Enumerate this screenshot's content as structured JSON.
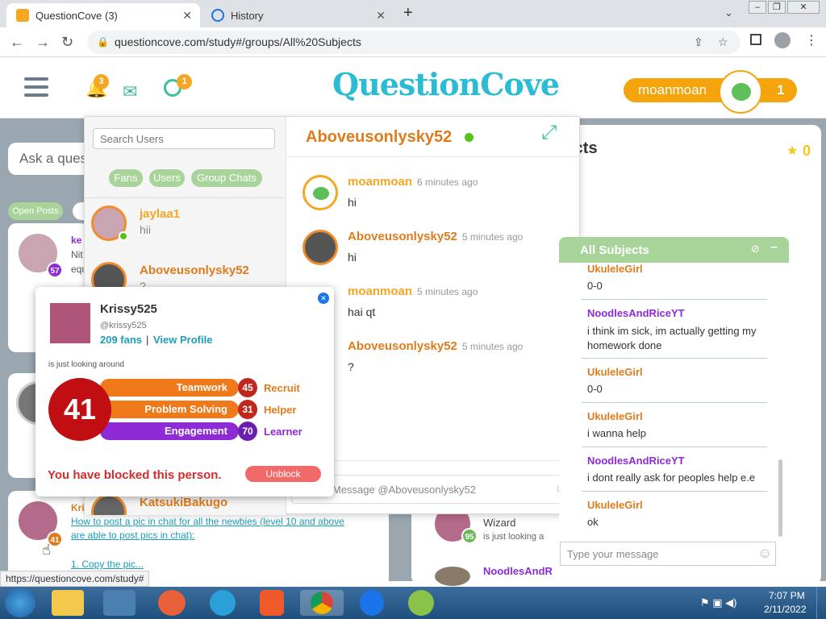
{
  "browser": {
    "tabs": [
      {
        "title": "QuestionCove (3)"
      },
      {
        "title": "History"
      }
    ],
    "new_tab": "+",
    "url": "questioncove.com/study#/groups/All%20Subjects",
    "status_url": "https://questioncove.com/study#"
  },
  "site": {
    "logo": "QuestionCove",
    "notif_count": "3",
    "friends_count": "1",
    "username": "moanmoan",
    "user_count": "1"
  },
  "background": {
    "ask_placeholder": "Ask a ques",
    "heading_partial": "jects",
    "open_posts": "Open Posts",
    "medal_count": "0",
    "card1_level": "57",
    "card2_level": "41",
    "card3_name_partial": "Kri",
    "card3_link1": "How to post a pic in chat for all the newbies (level 10 and above are able to post pics in chat):",
    "card3_link2": "1. Copy the pic...",
    "wizard_label": "Wizard",
    "wizard_status": "is just looking a",
    "wizard_level": "95",
    "bottom_name": "NoodlesAndR",
    "card1_name_partial": "ke",
    "card1_text_partial": "Nit",
    "card1_text_partial2": "equ"
  },
  "chat": {
    "search_placeholder": "Search Users",
    "filters": [
      "Fans",
      "Users",
      "Group Chats"
    ],
    "contacts": [
      {
        "name": "jaylaa1",
        "preview": "hii"
      },
      {
        "name": "Aboveusonlysky52",
        "preview": "?"
      },
      {
        "name": "KatsukiBakugo",
        "preview": ""
      }
    ],
    "partner": "Aboveusonlysky52",
    "messages": [
      {
        "name": "moanmoan",
        "time": "6 minutes ago",
        "text": "hi",
        "color": "#f5a623"
      },
      {
        "name": "Aboveusonlysky52",
        "time": "5 minutes ago",
        "text": "hi",
        "color": "#e07b1c"
      },
      {
        "name": "moanmoan",
        "time": "5 minutes ago",
        "text": "hai qt",
        "color": "#f5a623"
      },
      {
        "name": "Aboveusonlysky52",
        "time": "5 minutes ago",
        "text": "?",
        "color": "#e07b1c"
      }
    ],
    "input_placeholder": "Message @Aboveusonlysky52"
  },
  "profile": {
    "name": "Krissy525",
    "handle": "@krissy525",
    "fans": "209 fans",
    "view_profile": "View Profile",
    "status": "is just looking around",
    "score": "41",
    "stats": [
      {
        "label": "Teamwork",
        "value": "45",
        "rank": "Recruit",
        "color": "#f07a1a",
        "rank_color": "#e07b1c"
      },
      {
        "label": "Problem Solving",
        "value": "31",
        "rank": "Helper",
        "color": "#f07a1a",
        "rank_color": "#e07b1c"
      },
      {
        "label": "Engagement",
        "value": "70",
        "rank": "Learner",
        "color": "#8e2ad6",
        "rank_color": "#8e2ad6"
      }
    ],
    "blocked_text": "You have blocked this person.",
    "unblock": "Unblock"
  },
  "group_chat": {
    "title": "All Subjects",
    "messages": [
      {
        "name": "UkuleleGirl",
        "text": "0-0",
        "color": "#e07b1c"
      },
      {
        "name": "NoodlesAndRiceYT",
        "text": "i think im sick, im actually getting my homework done",
        "color": "#8e2ad6"
      },
      {
        "name": "UkuleleGirl",
        "text": "0-0",
        "color": "#e07b1c"
      },
      {
        "name": "UkuleleGirl",
        "text": "i wanna help",
        "color": "#e07b1c"
      },
      {
        "name": "NoodlesAndRiceYT",
        "text": "i dont really ask for peoples help e.e",
        "color": "#8e2ad6"
      },
      {
        "name": "UkuleleGirl",
        "text": "ok",
        "color": "#e07b1c"
      }
    ],
    "input_placeholder": "Type your message"
  },
  "taskbar": {
    "time": "7:07 PM",
    "date": "2/11/2022"
  }
}
